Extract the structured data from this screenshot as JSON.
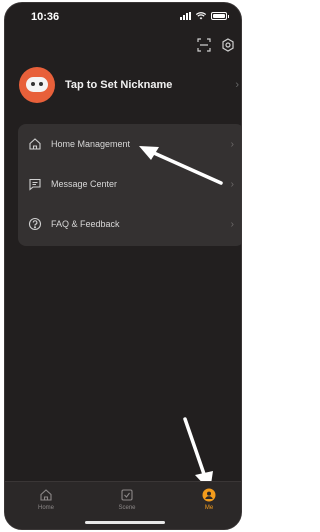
{
  "status_bar": {
    "time": "10:36"
  },
  "profile": {
    "nickname": "Tap to Set Nickname"
  },
  "menu": {
    "items": [
      {
        "label": "Home Management",
        "icon": "home-icon"
      },
      {
        "label": "Message Center",
        "icon": "message-icon"
      },
      {
        "label": "FAQ & Feedback",
        "icon": "help-icon"
      }
    ]
  },
  "tabbar": {
    "tabs": [
      {
        "label": "Home",
        "icon": "home-icon"
      },
      {
        "label": "Scene",
        "icon": "scene-icon"
      },
      {
        "label": "Me",
        "icon": "user-icon",
        "active": true
      }
    ],
    "active_color": "#f39c1c"
  },
  "colors": {
    "background": "#221f1f",
    "card": "#343131",
    "accent": "#f39c1c",
    "avatar": "#e8603a"
  }
}
